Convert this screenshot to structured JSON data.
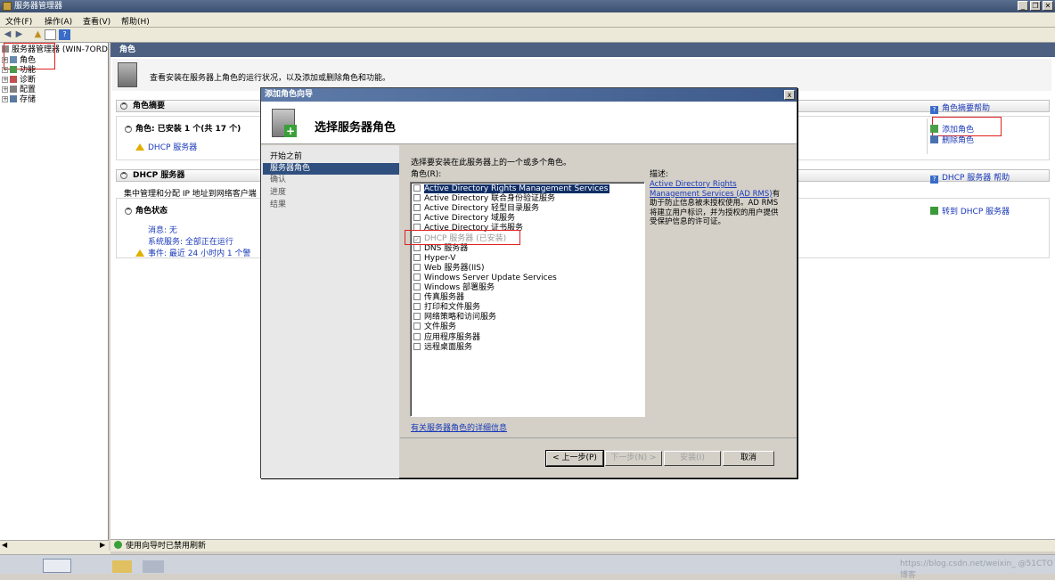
{
  "window": {
    "title": "服务器管理器"
  },
  "window_buttons": {
    "minimize": "_",
    "restore": "❐",
    "close": "✕"
  },
  "menu": [
    "文件(F)",
    "操作(A)",
    "查看(V)",
    "帮助(H)"
  ],
  "toolbar": {
    "help": "?"
  },
  "tree": {
    "root": "服务器管理器 (WIN-7ORD",
    "items": [
      "角色",
      "功能",
      "诊断",
      "配置",
      "存储"
    ],
    "expand": "+"
  },
  "main": {
    "header": "角色",
    "banner_text": "查看安装在服务器上角色的运行状况，以及添加或删除角色和功能。",
    "role_summary": {
      "title": "角色摘要",
      "roles_line": "角色: 已安装 1 个(共 17 个)",
      "installed_role": "DHCP 服务器",
      "help": "角色摘要帮助",
      "add_roles": "添加角色",
      "remove_roles": "删除角色"
    },
    "dhcp": {
      "title": "DHCP 服务器",
      "help": "DHCP 服务器 帮助",
      "description": "集中管理和分配 IP 地址到网络客户端",
      "status_title": "角色状态",
      "goto": "转到 DHCP 服务器",
      "messages": "消息: 无",
      "system_services": "系统服务: 全部正在运行",
      "events": "事件: 最近 24 小时内 1 个警"
    },
    "status_bar": "使用向导时已禁用刷新"
  },
  "dialog": {
    "title": "添加角色向导",
    "close": "x",
    "heading": "选择服务器角色",
    "nav": [
      "开始之前",
      "服务器角色",
      "确认",
      "进度",
      "结果"
    ],
    "nav_selected_index": 1,
    "instruction": "选择要安装在此服务器上的一个或多个角色。",
    "roles_label": "角色(R):",
    "roles": [
      {
        "label": "Active Directory Rights Management Services",
        "checked": false,
        "selected": true,
        "disabled": false
      },
      {
        "label": "Active Directory 联合身份验证服务",
        "checked": false,
        "selected": false,
        "disabled": false
      },
      {
        "label": "Active Directory 轻型目录服务",
        "checked": false,
        "selected": false,
        "disabled": false
      },
      {
        "label": "Active Directory 域服务",
        "checked": false,
        "selected": false,
        "disabled": false
      },
      {
        "label": "Active Directory 证书服务",
        "checked": false,
        "selected": false,
        "disabled": false
      },
      {
        "label": "DHCP 服务器  (已安装)",
        "checked": true,
        "selected": false,
        "disabled": true
      },
      {
        "label": "DNS 服务器",
        "checked": false,
        "selected": false,
        "disabled": false
      },
      {
        "label": "Hyper-V",
        "checked": false,
        "selected": false,
        "disabled": false
      },
      {
        "label": "Web 服务器(IIS)",
        "checked": false,
        "selected": false,
        "disabled": false
      },
      {
        "label": "Windows Server Update Services",
        "checked": false,
        "selected": false,
        "disabled": false
      },
      {
        "label": "Windows 部署服务",
        "checked": false,
        "selected": false,
        "disabled": false
      },
      {
        "label": "传真服务器",
        "checked": false,
        "selected": false,
        "disabled": false
      },
      {
        "label": "打印和文件服务",
        "checked": false,
        "selected": false,
        "disabled": false
      },
      {
        "label": "网络策略和访问服务",
        "checked": false,
        "selected": false,
        "disabled": false
      },
      {
        "label": "文件服务",
        "checked": false,
        "selected": false,
        "disabled": false
      },
      {
        "label": "应用程序服务器",
        "checked": false,
        "selected": false,
        "disabled": false
      },
      {
        "label": "远程桌面服务",
        "checked": false,
        "selected": false,
        "disabled": false
      }
    ],
    "description_label": "描述:",
    "description_link": "Active Directory Rights Management Services (AD RMS)",
    "description_text": "有助于防止信息被未授权使用。AD RMS 将建立用户标识，并为授权的用户提供受保护信息的许可证。",
    "more_info_link": "有关服务器角色的详细信息",
    "buttons": {
      "back": "< 上一步(P)",
      "next": "下一步(N) >",
      "install": "安装(I)",
      "cancel": "取消"
    }
  },
  "watermark": "https://blog.csdn.net/weixin_ @51CTO博客",
  "colors": {
    "header": "#4d6082",
    "link": "#1a3ab8",
    "selection": "#102e66",
    "annotation": "#e02020"
  }
}
